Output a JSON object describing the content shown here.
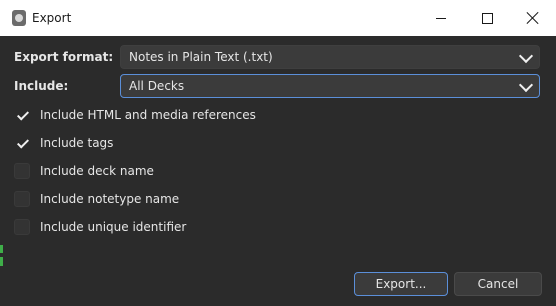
{
  "window": {
    "title": "Export"
  },
  "form": {
    "format_label": "Export format:",
    "format_value": "Notes in Plain Text (.txt)",
    "include_label": "Include:",
    "include_value": "All Decks"
  },
  "options": [
    {
      "label": "Include HTML and media references",
      "checked": true
    },
    {
      "label": "Include tags",
      "checked": true
    },
    {
      "label": "Include deck name",
      "checked": false
    },
    {
      "label": "Include notetype name",
      "checked": false
    },
    {
      "label": "Include unique identifier",
      "checked": false
    }
  ],
  "buttons": {
    "export_label": "Export...",
    "cancel_label": "Cancel"
  },
  "colors": {
    "background": "#2b2b2b",
    "accent": "#5b8fd9",
    "titlebar": "#ffffff"
  }
}
